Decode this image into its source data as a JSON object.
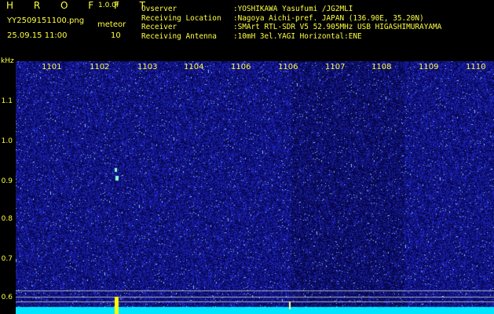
{
  "header": {
    "app_title": "H R O F F T",
    "version": "1.0.0f",
    "file_name": "YY2509151100.png",
    "timestamp": "25.09.15 11:00",
    "meteor_label": "meteor",
    "meteor_count": "10"
  },
  "station_info": [
    {
      "key": "Ovserver",
      "value": ":YOSHIKAWA Yasufumi /JG2MLI"
    },
    {
      "key": "Receiving Location",
      "value": ":Nagoya Aichi-pref. JAPAN (136.90E, 35.20N)"
    },
    {
      "key": "Receiver",
      "value": ":SMArt RTL-SDR V5 52.905MHz USB HIGASHIMURAYAMA"
    },
    {
      "key": "Receiving Antenna",
      "value": ":10mH 3el.YAGI Horizontal:ENE"
    }
  ],
  "y_axis": {
    "unit": "kHz",
    "ticks": [
      "1.1",
      "1.0",
      "0.9",
      "0.8",
      "0.7",
      "0.6"
    ]
  },
  "x_axis": {
    "ticks": [
      "1101",
      "1102",
      "1103",
      "1104",
      "1106",
      "1106",
      "1107",
      "1108",
      "1109",
      "1110"
    ]
  },
  "colors": {
    "text": "#ffff40",
    "background_noise": "#0a0a70",
    "baseline": "#00e5ff",
    "meteor_trace": "#ffff00"
  }
}
